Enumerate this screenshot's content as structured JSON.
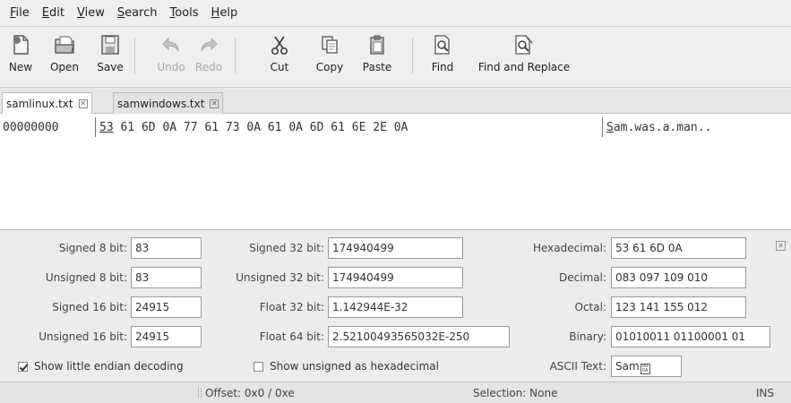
{
  "menubar": {
    "items": [
      {
        "label": "File",
        "mnemonic": "F",
        "rest": "ile"
      },
      {
        "label": "Edit",
        "mnemonic": "E",
        "rest": "dit"
      },
      {
        "label": "View",
        "mnemonic": "V",
        "rest": "iew"
      },
      {
        "label": "Search",
        "mnemonic": "S",
        "rest": "earch"
      },
      {
        "label": "Tools",
        "mnemonic": "T",
        "rest": "ools"
      },
      {
        "label": "Help",
        "mnemonic": "H",
        "rest": "elp"
      }
    ]
  },
  "toolbar": {
    "new": "New",
    "open": "Open",
    "save": "Save",
    "undo": "Undo",
    "redo": "Redo",
    "cut": "Cut",
    "copy": "Copy",
    "paste": "Paste",
    "find": "Find",
    "find_replace": "Find and Replace"
  },
  "tabs": [
    {
      "label": "samlinux.txt",
      "active": true
    },
    {
      "label": "samwindows.txt",
      "active": false
    }
  ],
  "hexview": {
    "offset": "00000000",
    "first_byte": "53",
    "hex_rest": " 61 6D 0A 77 61 73 0A 61 0A 6D 61 6E 2E 0A",
    "ascii_first": "S",
    "ascii_rest": "am.was.a.man.."
  },
  "decoder": {
    "signed8_label": "Signed 8 bit:",
    "signed8": "83",
    "unsigned8_label": "Unsigned 8 bit:",
    "unsigned8": "83",
    "signed16_label": "Signed 16 bit:",
    "signed16": "24915",
    "unsigned16_label": "Unsigned 16 bit:",
    "unsigned16": "24915",
    "signed32_label": "Signed 32 bit:",
    "signed32": "174940499",
    "unsigned32_label": "Unsigned 32 bit:",
    "unsigned32": "174940499",
    "float32_label": "Float 32 bit:",
    "float32": "1.142944E-32",
    "float64_label": "Float 64 bit:",
    "float64": "2.52100493565032E-250",
    "hex_label": "Hexadecimal:",
    "hex": "53 61 6D 0A",
    "dec_label": "Decimal:",
    "dec": "083 097 109 010",
    "oct_label": "Octal:",
    "oct": "123 141 155 012",
    "bin_label": "Binary:",
    "bin": "01010011 01100001 01",
    "ascii_label": "ASCII Text:",
    "ascii": "Sam",
    "little_endian_label": "Show little endian decoding",
    "little_endian_checked": true,
    "unsigned_hex_label": "Show unsigned as hexadecimal",
    "unsigned_hex_checked": false
  },
  "statusbar": {
    "offset": "Offset: 0x0 / 0xe",
    "selection": "Selection: None",
    "mode": "INS"
  }
}
